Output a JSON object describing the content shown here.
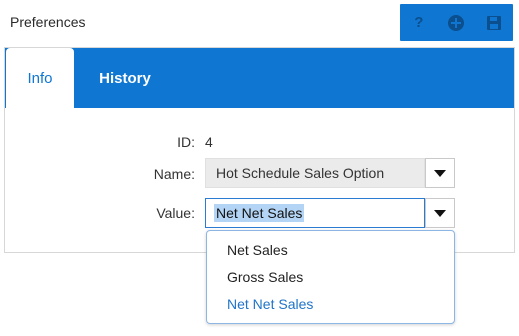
{
  "header": {
    "title": "Preferences"
  },
  "toolbar": {
    "help_label": "?",
    "buttons": [
      "help-icon",
      "add-icon",
      "save-icon"
    ]
  },
  "tabs": [
    {
      "label": "Info"
    },
    {
      "label": "History"
    }
  ],
  "form": {
    "id_label": "ID:",
    "id_value": "4",
    "name_label": "Name:",
    "name_value": "Hot Schedule Sales Option",
    "value_label": "Value:",
    "value_value": "Net Net Sales"
  },
  "dropdown": {
    "options": [
      "Net Sales",
      "Gross Sales",
      "Net Net Sales"
    ],
    "selected": "Net Net Sales"
  },
  "colors": {
    "accent": "#0f76d2",
    "selected_option": "#1f74c9"
  }
}
